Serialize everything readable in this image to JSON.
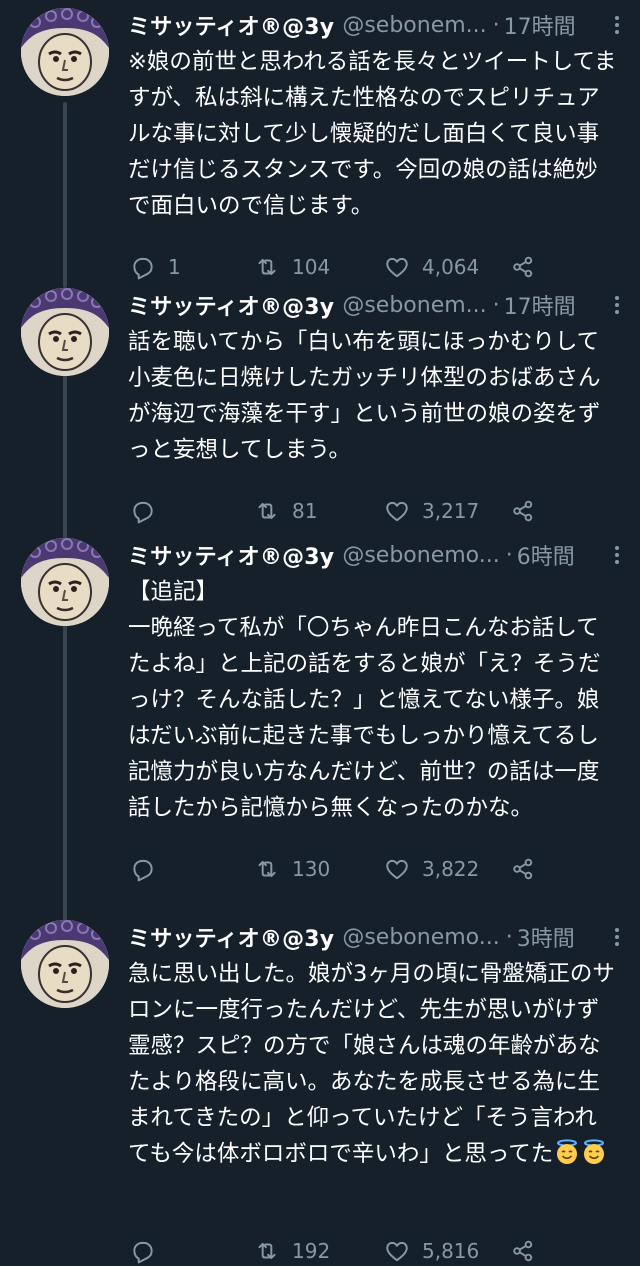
{
  "tweets": [
    {
      "name": "ミサッティオ®@3y",
      "handle": "@sebonem...",
      "time": "17時間",
      "text": "※娘の前世と思われる話を長々とツイートしてますが、私は斜に構えた性格なのでスピリチュアルな事に対して少し懐疑的だし面白くて良い事だけ信じるスタンスです。今回の娘の話は絶妙で面白いので信じます。",
      "emoji": "",
      "replies": "1",
      "retweets": "104",
      "likes": "4,064"
    },
    {
      "name": "ミサッティオ®@3y",
      "handle": "@sebonem...",
      "time": "17時間",
      "text": "話を聴いてから「白い布を頭にほっかむりして小麦色に日焼けしたガッチリ体型のおばあさんが海辺で海藻を干す」という前世の娘の姿をずっと妄想してしまう。",
      "emoji": "",
      "replies": "",
      "retweets": "81",
      "likes": "3,217"
    },
    {
      "name": "ミサッティオ®@3y",
      "handle": "@sebonemo...",
      "time": "6時間",
      "text": "【追記】\n一晩経って私が「〇ちゃん昨日こんなお話してたよね」と上記の話をすると娘が「え？そうだっけ？そんな話した？」と憶えてない様子。娘はだいぶ前に起きた事でもしっかり憶えてるし記憶力が良い方なんだけど、前世？の話は一度話したから記憶から無くなったのかな。",
      "emoji": "",
      "replies": "",
      "retweets": "130",
      "likes": "3,822"
    },
    {
      "name": "ミサッティオ®@3y",
      "handle": "@sebonemo...",
      "time": "3時間",
      "text": "急に思い出した。娘が3ヶ月の頃に骨盤矯正のサロンに一度行ったんだけど、先生が思いがけず霊感？スピ？の方で「娘さんは魂の年齢があなたより格段に高い。あなたを成長させる為に生まれてきたの」と仰っていたけど「そう言われても今は体ボロボロで辛いわ」と思ってた",
      "emoji": "😇😇",
      "replies": "",
      "retweets": "192",
      "likes": "5,816"
    }
  ],
  "colors": {
    "background": "#15202b",
    "text": "#ffffff",
    "secondary": "#8899a6",
    "thread_line": "#38444d"
  },
  "icons": {
    "reply": "reply-icon",
    "retweet": "retweet-icon",
    "like": "heart-icon",
    "share": "share-icon",
    "more": "more-icon"
  }
}
